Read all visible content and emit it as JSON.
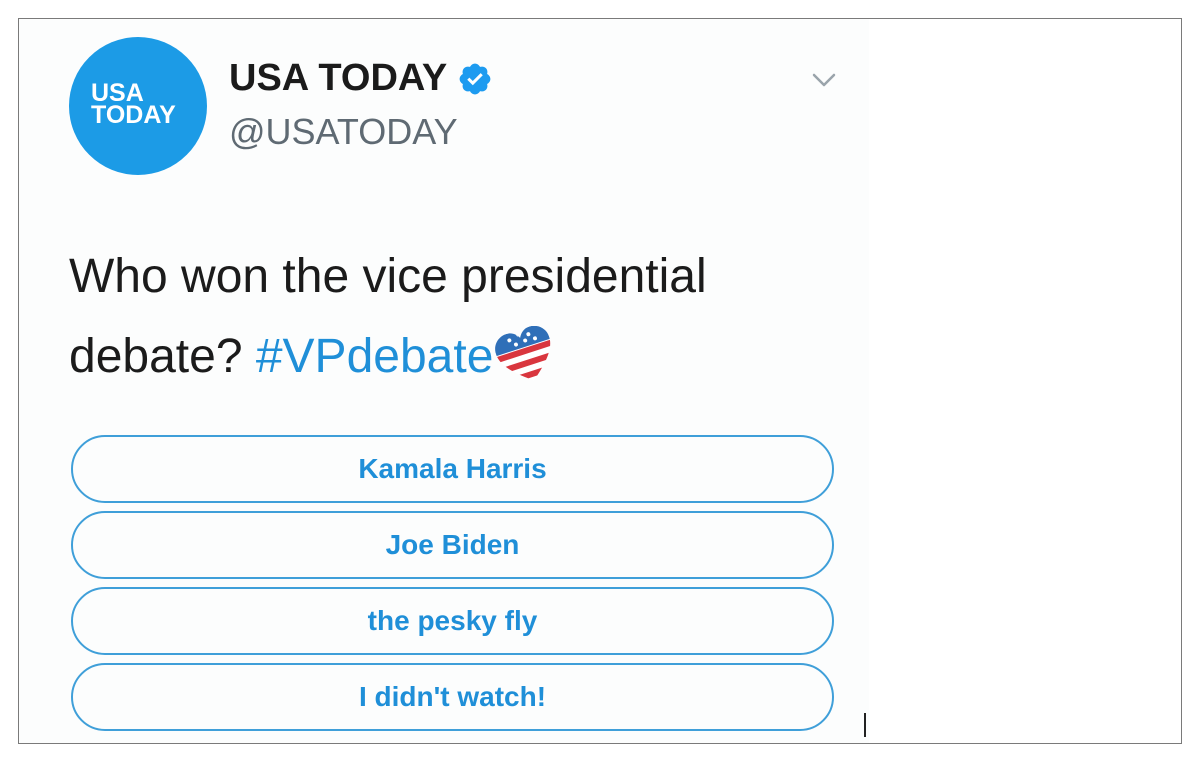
{
  "tweet": {
    "avatar": {
      "line1": "USA",
      "line2": "TODAY",
      "color": "#1c9be6"
    },
    "display_name": "USA TODAY",
    "verified_icon": "verified-badge-icon",
    "handle": "@USATODAY",
    "menu_icon": "chevron-down-icon",
    "text": "Who won the vice presidential debate? ",
    "hashtag": "#VPdebate",
    "emoji_icon": "american-flag-heart-icon"
  },
  "poll": {
    "options": [
      {
        "label": "Kamala Harris"
      },
      {
        "label": "Joe Biden"
      },
      {
        "label": "the pesky fly"
      },
      {
        "label": "I didn't watch!"
      }
    ]
  },
  "colors": {
    "accent": "#1f8fd8",
    "text": "#1b1b1b",
    "muted": "#5f6a73",
    "border": "#3f9fd9"
  }
}
